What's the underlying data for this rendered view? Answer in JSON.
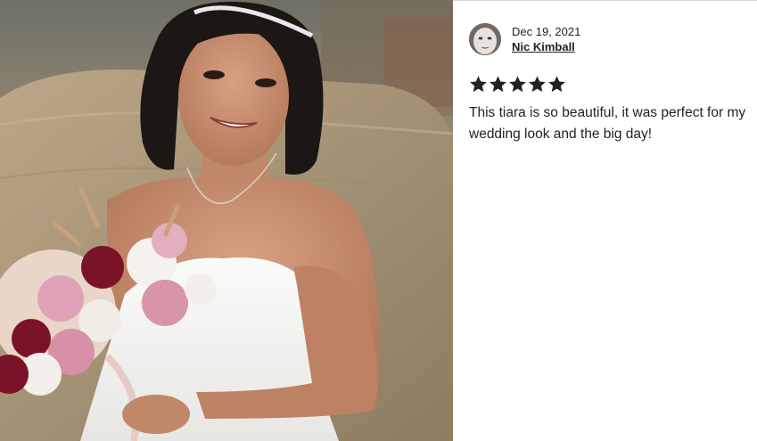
{
  "review": {
    "date": "Dec 19, 2021",
    "reviewer_name": "Nic Kimball",
    "rating": 5,
    "rating_max": 5,
    "text": "This tiara is so beautiful, it was perfect for my wedding look and the big day!"
  },
  "icons": {
    "star": "star-icon",
    "avatar": "avatar"
  },
  "colors": {
    "text": "#222222",
    "star": "#222222",
    "divider": "#d8d8d8"
  }
}
